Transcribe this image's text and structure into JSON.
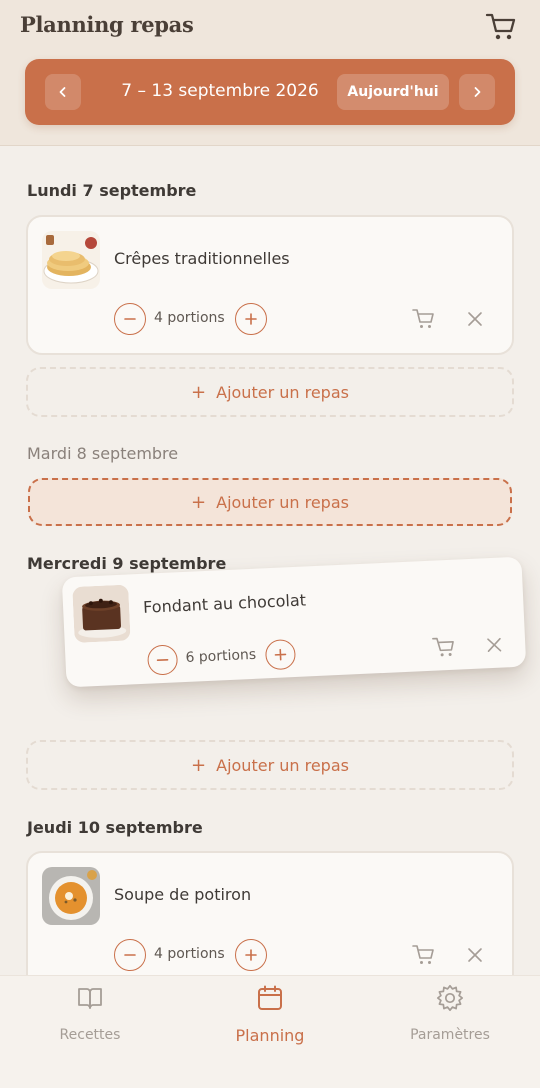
{
  "header": {
    "title": "Planning repas",
    "week_label": "7 – 13 septembre 2026",
    "today_label": "Aujourd'hui"
  },
  "days": [
    {
      "title": "Lundi 7 septembre",
      "meals": [
        {
          "name": "Crêpes traditionnelles",
          "portions": "4 portions"
        }
      ],
      "add_label": "Ajouter un repas"
    },
    {
      "title": "Mardi 8 septembre",
      "meals": [],
      "add_label": "Ajouter un repas"
    },
    {
      "title": "Mercredi 9 septembre",
      "meals": [
        {
          "name": "Fondant au chocolat",
          "portions": "6 portions"
        }
      ],
      "add_label": "Ajouter un repas"
    },
    {
      "title": "Jeudi 10 septembre",
      "meals": [
        {
          "name": "Soupe de potiron",
          "portions": "4 portions"
        }
      ],
      "add_label": "Ajouter un repas"
    }
  ],
  "nav": {
    "items": [
      {
        "label": "Recettes",
        "icon": "book-icon"
      },
      {
        "label": "Planning",
        "icon": "calendar-icon",
        "active": true
      },
      {
        "label": "Paramètres",
        "icon": "gear-icon"
      }
    ]
  },
  "colors": {
    "accent": "#c9704a",
    "background": "#f3efea",
    "header_background": "#efe6dc",
    "card_background": "#fbf9f6",
    "drop_target_background": "#f4e4d9"
  }
}
